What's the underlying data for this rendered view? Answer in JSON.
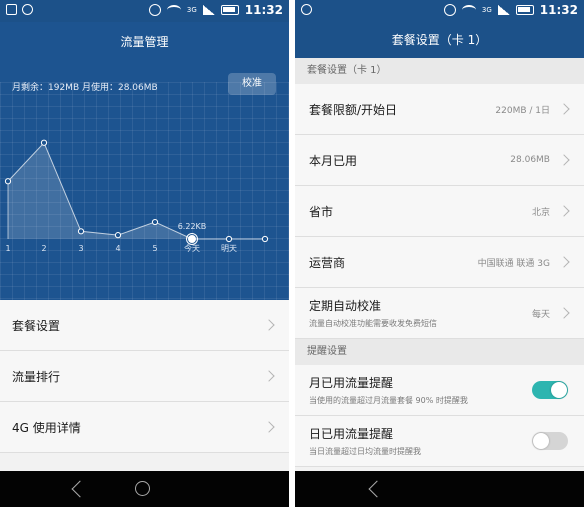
{
  "status_bar": {
    "time": "11:32",
    "network": "3G"
  },
  "left": {
    "title": "流量管理",
    "usage_text": "月剩余：192MB 月使用：28.06MB",
    "calibrate_label": "校准",
    "chart_data": {
      "type": "area",
      "categories": [
        "1",
        "2",
        "3",
        "4",
        "5",
        "今天",
        "明天",
        ""
      ],
      "values": [
        7.5,
        12.5,
        1.0,
        0.5,
        2.2,
        0.0,
        0.0,
        0.0
      ],
      "current_label": "6.22KB",
      "highlight_category": "今天"
    },
    "menu": [
      "套餐设置",
      "流量排行",
      "4G 使用详情"
    ]
  },
  "right": {
    "title": "套餐设置（卡 1）",
    "section_plan": "套餐设置（卡 1）",
    "limit_label": "套餐限额/开始日",
    "limit_value": "220MB / 1日",
    "used_label": "本月已用",
    "used_value": "28.06MB",
    "province_label": "省市",
    "province_value": "北京",
    "carrier_label": "运营商",
    "carrier_value": "中国联通 联通 3G",
    "auto_label": "定期自动校准",
    "auto_sub": "流量自动校准功能需要收发免费短信",
    "auto_value": "每天",
    "section_remind": "提醒设置",
    "month_remind_label": "月已用流量提醒",
    "month_remind_sub": "当使用的流量超过月流量套餐 90% 时提醒我",
    "day_remind_label": "日已用流量提醒",
    "day_remind_sub": "当日流量超过日均流量时提醒我",
    "month_remind_on": true,
    "day_remind_on": false
  },
  "colors": {
    "primary": "#1c5189",
    "toggle_on": "#2eb5b0"
  }
}
